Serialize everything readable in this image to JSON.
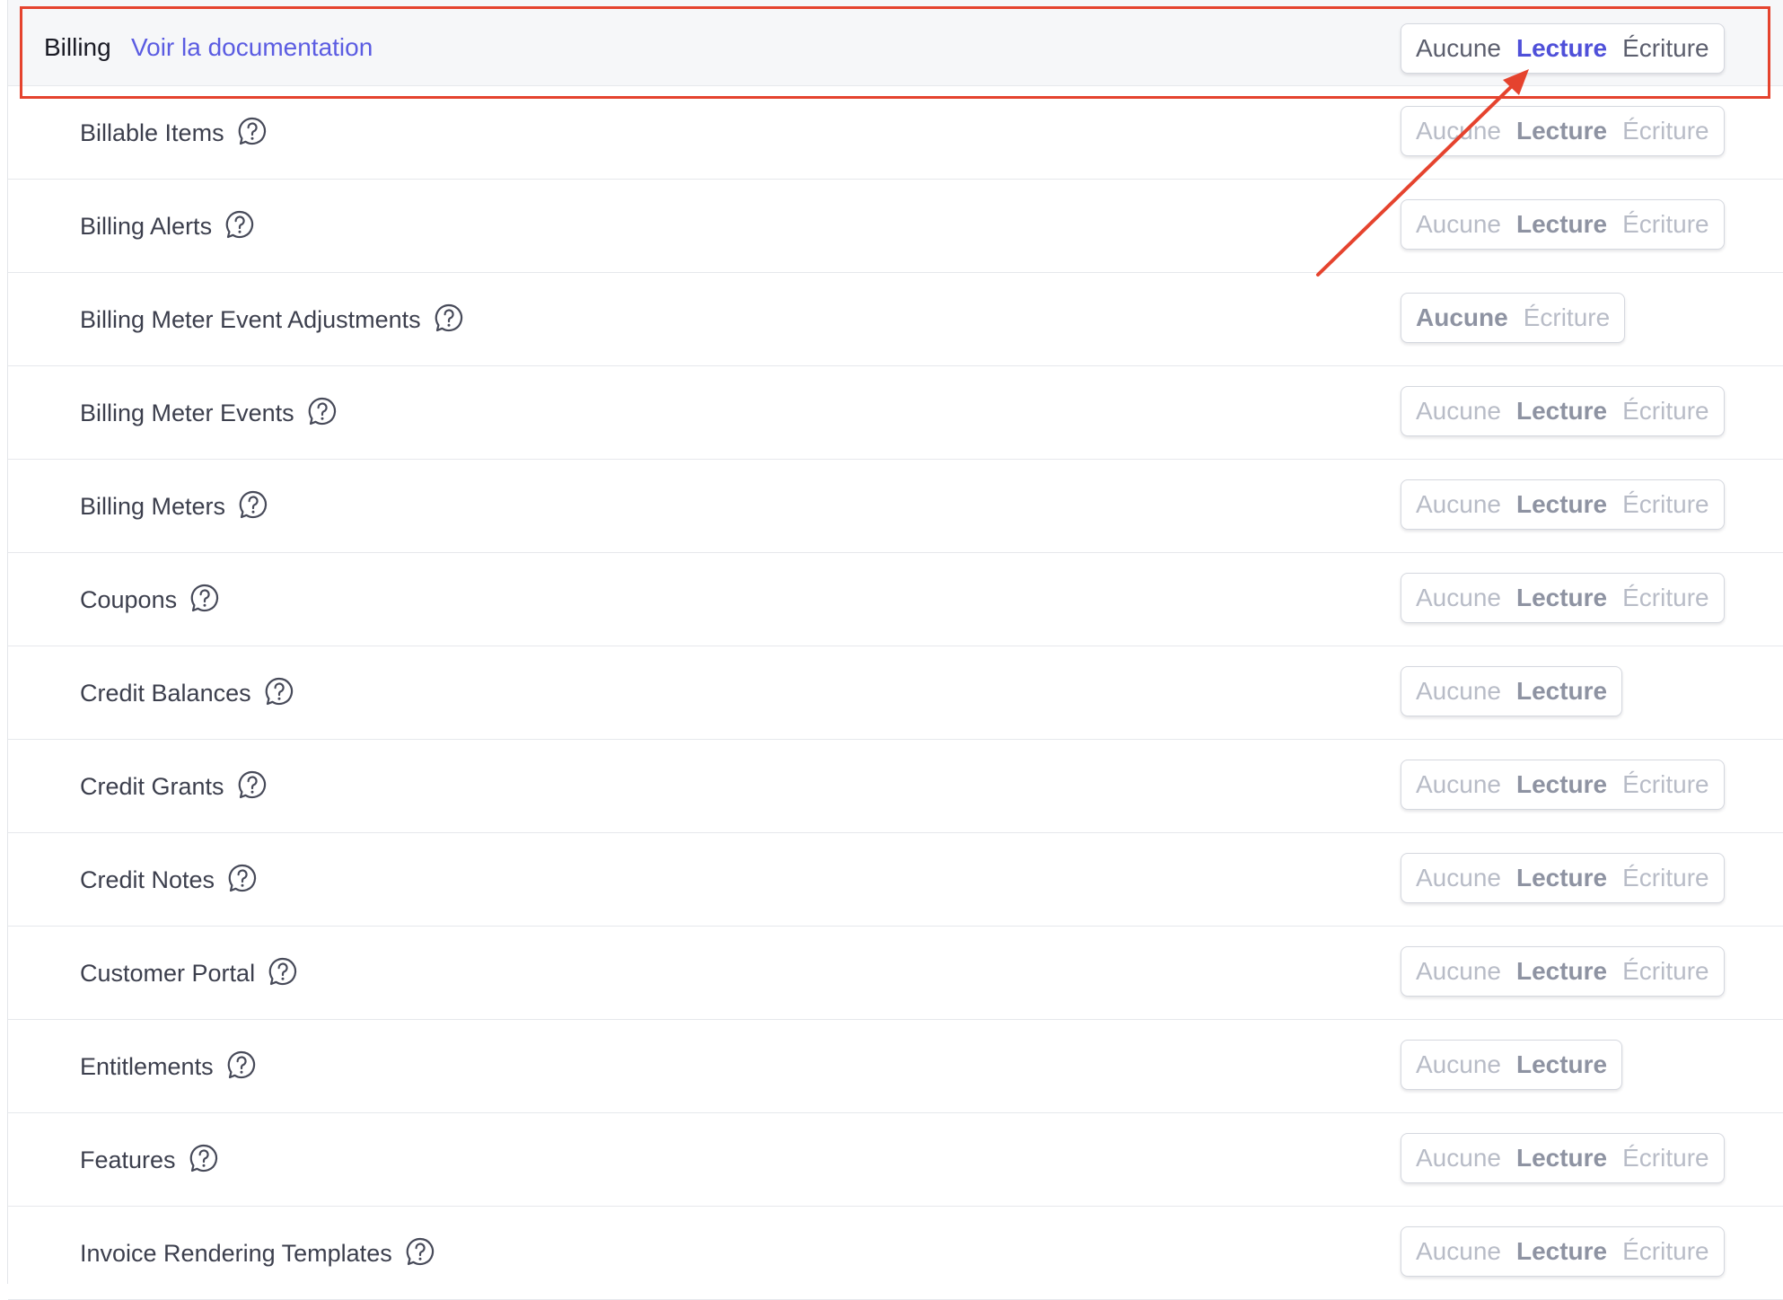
{
  "header": {
    "title": "Billing",
    "doc_link": "Voir la documentation",
    "options": {
      "none": "Aucune",
      "read": "Lecture",
      "write": "Écriture"
    },
    "selected": "read"
  },
  "labels": {
    "none": "Aucune",
    "read": "Lecture",
    "write": "Écriture"
  },
  "rows": [
    {
      "label": "Billable Items",
      "options": [
        "none",
        "read",
        "write"
      ]
    },
    {
      "label": "Billing Alerts",
      "options": [
        "none",
        "read",
        "write"
      ]
    },
    {
      "label": "Billing Meter Event Adjustments",
      "options": [
        "none",
        "write"
      ]
    },
    {
      "label": "Billing Meter Events",
      "options": [
        "none",
        "read",
        "write"
      ]
    },
    {
      "label": "Billing Meters",
      "options": [
        "none",
        "read",
        "write"
      ]
    },
    {
      "label": "Coupons",
      "options": [
        "none",
        "read",
        "write"
      ]
    },
    {
      "label": "Credit Balances",
      "options": [
        "none",
        "read"
      ]
    },
    {
      "label": "Credit Grants",
      "options": [
        "none",
        "read",
        "write"
      ]
    },
    {
      "label": "Credit Notes",
      "options": [
        "none",
        "read",
        "write"
      ]
    },
    {
      "label": "Customer Portal",
      "options": [
        "none",
        "read",
        "write"
      ]
    },
    {
      "label": "Entitlements",
      "options": [
        "none",
        "read"
      ]
    },
    {
      "label": "Features",
      "options": [
        "none",
        "read",
        "write"
      ]
    },
    {
      "label": "Invoice Rendering Templates",
      "options": [
        "none",
        "read",
        "write"
      ]
    }
  ],
  "icons": {
    "help": "help-question-icon"
  },
  "colors": {
    "accent": "#4f50d9",
    "link": "#5b5ce2",
    "annotation": "#e5432e"
  }
}
